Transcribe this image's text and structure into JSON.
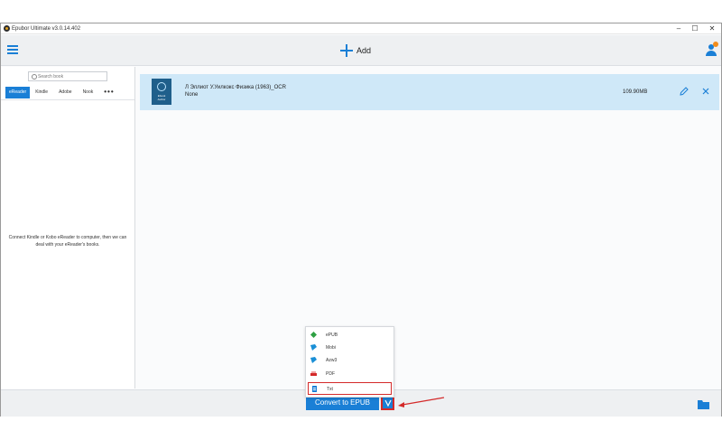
{
  "window": {
    "title": "Epubor Ultimate v3.0.14.402",
    "controls": [
      "–",
      "☐",
      "✕"
    ]
  },
  "toolbar": {
    "menu_icon": "hamburger-icon",
    "add_label": "Add",
    "user_icon": "user-icon"
  },
  "sidebar": {
    "search_placeholder": "Search book",
    "tabs": [
      "eReader",
      "Kindle",
      "Adobe",
      "Nook",
      "•••"
    ],
    "active_tab": "eReader",
    "message": "Connect Kindle or Kobo eReader to computer, then we can deal with your eReader's books."
  },
  "book": {
    "title": "Л Эллиот У.Уилкокс Физика (1963)_OCR",
    "author": "None",
    "size": "109.90MB",
    "cover_line1": "Ebook",
    "cover_line2": "Author"
  },
  "format_menu": {
    "items": [
      {
        "label": "ePUB",
        "icon": "epub-icon",
        "color": "#2ea043"
      },
      {
        "label": "Mobi",
        "icon": "mobi-icon",
        "color": "#1a8fd6"
      },
      {
        "label": "Azw3",
        "icon": "azw3-icon",
        "color": "#1a8fd6"
      },
      {
        "label": "PDF",
        "icon": "pdf-icon",
        "color": "#d42a2a"
      },
      {
        "label": "Txt",
        "icon": "txt-icon",
        "color": "#1a7fd6"
      }
    ],
    "selected": "Txt"
  },
  "bottom": {
    "convert_label": "Convert to EPUB",
    "dropdown_label": "V"
  },
  "colors": {
    "accent": "#1a7fd6",
    "highlight": "#d42a2a",
    "row_selected": "#cfe8f8"
  }
}
